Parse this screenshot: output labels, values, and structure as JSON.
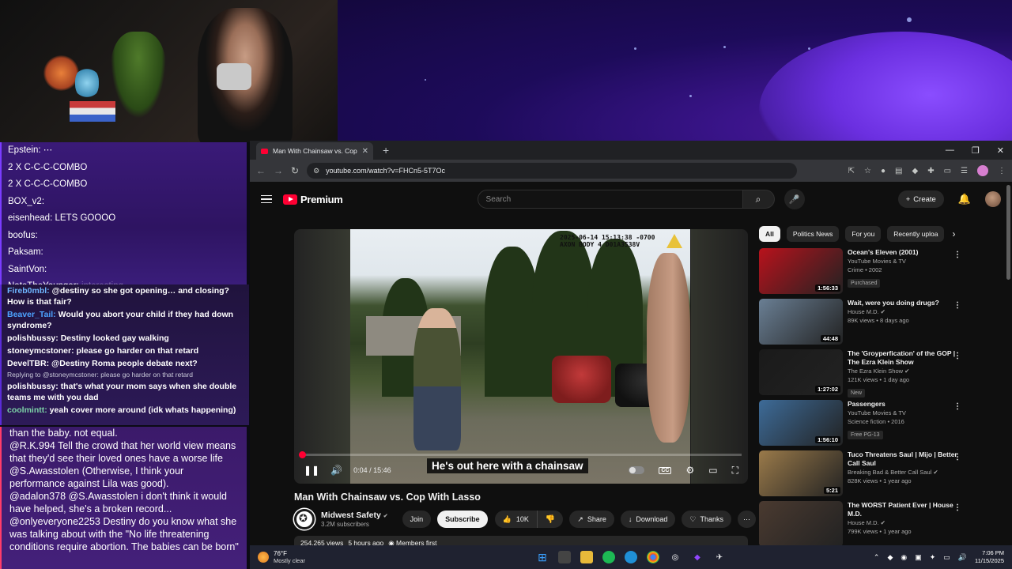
{
  "chat_top": [
    {
      "user": "Epstein:",
      "text": "⋯"
    },
    {
      "user": "",
      "text": "2 X C-C-C-COMBO"
    },
    {
      "user": "",
      "text": "2 X C-C-C-COMBO"
    },
    {
      "user": "BOX_v2:",
      "text": ""
    },
    {
      "user": "eisenhead:",
      "text": "LETS GOOOO"
    },
    {
      "user": "boofus:",
      "text": ""
    },
    {
      "user": "Paksam:",
      "text": ""
    },
    {
      "user": "SaintVon:",
      "text": ""
    },
    {
      "user": "NateTheYounger:",
      "text": "interesting"
    }
  ],
  "chat_mid": [
    {
      "type": "msg",
      "user": "Fireb0mbl:",
      "text": "@destiny so she got opening… and closing? How is that fair?",
      "color": "#6fb7ff"
    },
    {
      "type": "msg",
      "user": "Beaver_Tail:",
      "text": "Would you abort your child if they had down syndrome?",
      "color": "#4da3ff"
    },
    {
      "type": "msg",
      "user": "polishbussy:",
      "text": "Destiny looked gay walking",
      "color": "#ffffff"
    },
    {
      "type": "msg",
      "user": "stoneymcstoner:",
      "text": "please go harder on that retard",
      "color": "#ffffff"
    },
    {
      "type": "msg",
      "user": "DevelTBR:",
      "text": "@Destiny Roma people debate next?",
      "color": "#ffffff"
    },
    {
      "type": "reply",
      "text": "Replying to @stoneymcstoner: please go harder on that retard"
    },
    {
      "type": "msg",
      "user": "polishbussy:",
      "text": "that's what your mom says when she double teams me with you dad",
      "color": "#ffffff"
    },
    {
      "type": "msg",
      "user": "coolmintt:",
      "text": "yeah cover more around (idk whats happening)",
      "color": "#7dd3a8"
    }
  ],
  "chat_bot": [
    {
      "user": "",
      "text": "than the baby. not equal."
    },
    {
      "user": "@R.K.994",
      "text": "Tell the crowd that her world view means that they'd see their loved ones have a worse life"
    },
    {
      "user": "@S.Awasstolen",
      "text": "(Otherwise, I think your performance against Lila was good)."
    },
    {
      "user": "@adalon378",
      "text": "@S.Awasstolen i don't think it would have helped, she's a broken record..."
    },
    {
      "user": "@onlyeveryone2253",
      "text": "Destiny do you know what she was talking about with the \"No life threatening conditions require abortion. The babies can be born\""
    }
  ],
  "browser": {
    "tab_title": "Man With Chainsaw vs. Cop",
    "url": "youtube.com/watch?v=FHCn5-5T7Oc"
  },
  "youtube": {
    "logo": "Premium",
    "search_placeholder": "Search",
    "create_label": "Create",
    "player": {
      "stamp_line1": "2025-06-14 15:13:38 -0700",
      "stamp_line2": "AXON BODY 4 D01A3538V",
      "caption": "He's out here with a chainsaw",
      "time": "0:04 / 15:46",
      "progress_fraction": 0.004
    },
    "video_title": "Man With Chainsaw vs. Cop With Lasso",
    "channel": {
      "name": "Midwest Safety",
      "subscribers": "3.2M subscribers",
      "join": "Join",
      "subscribe": "Subscribe"
    },
    "actions": {
      "likes": "10K",
      "share": "Share",
      "download": "Download",
      "thanks": "Thanks"
    },
    "description": {
      "views": "254,265 views",
      "age": "5 hours ago",
      "badge": "Members first"
    },
    "chips": [
      "All",
      "Politics News",
      "For you",
      "Recently uploa"
    ],
    "recommendations": [
      {
        "title": "Ocean's Eleven (2001)",
        "meta1": "YouTube Movies & TV",
        "meta2": "Crime • 2002",
        "badge": "Purchased",
        "duration": "1:56:33",
        "thumb": "#b8121c"
      },
      {
        "title": "Wait, were you doing drugs?",
        "meta1": "House M.D. ✔",
        "meta2": "89K views • 8 days ago",
        "badge": "",
        "duration": "44:48",
        "thumb": "#6a7f94"
      },
      {
        "title": "The 'Groyperfication' of the GOP | The Ezra Klein Show",
        "meta1": "The Ezra Klein Show ✔",
        "meta2": "121K views • 1 day ago",
        "badge": "New",
        "duration": "1:27:02",
        "thumb": "#1a1a1a"
      },
      {
        "title": "Passengers",
        "meta1": "YouTube Movies & TV",
        "meta2": "Science fiction • 2016",
        "badge": "Free   PG-13",
        "duration": "1:56:10",
        "thumb": "#3d6b98"
      },
      {
        "title": "Tuco Threatens Saul | Mijo | Better Call Saul",
        "meta1": "Breaking Bad & Better Call Saul ✔",
        "meta2": "828K views • 1 year ago",
        "badge": "",
        "duration": "5:21",
        "thumb": "#9a7a4a"
      },
      {
        "title": "The WORST Patient Ever | House M.D.",
        "meta1": "House M.D. ✔",
        "meta2": "799K views • 1 year ago",
        "badge": "",
        "duration": "",
        "thumb": "#4a3a30"
      }
    ]
  },
  "taskbar": {
    "temp": "76°F",
    "condition": "Mostly clear",
    "time": "7:06 PM",
    "date": "11/15/2025"
  }
}
